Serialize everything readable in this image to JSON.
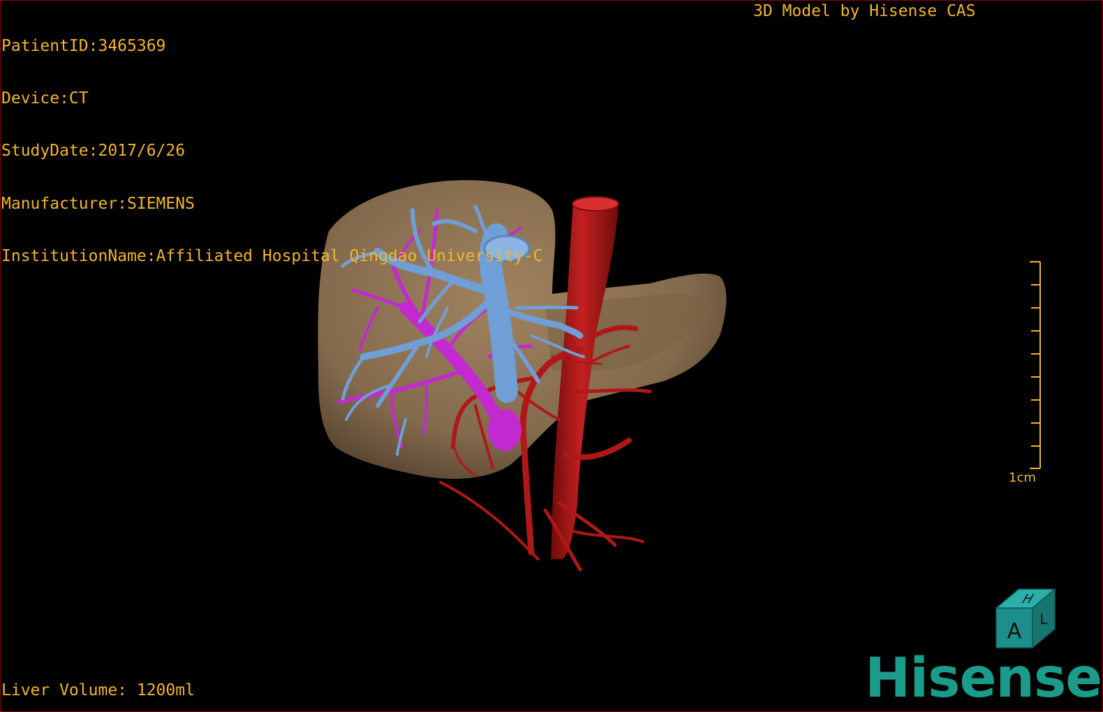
{
  "patient_info": {
    "patient_id": "PatientID:3465369",
    "device": "Device:CT",
    "study_date": "StudyDate:2017/6/26",
    "manufacturer": "Manufacturer:SIEMENS",
    "institution": "InstitutionName:Affiliated Hospital Qingdao University-C"
  },
  "model_credit": "3D Model by Hisense CAS",
  "liver_volume": "Liver Volume: 1200ml",
  "scale_bar": {
    "label": "1cm"
  },
  "orientation_cube": {
    "front_label": "A",
    "top_label": "H",
    "side_label": "L"
  },
  "brand": "Hisense",
  "colors": {
    "overlay_text": "#f2b52a",
    "liver": "#8b7051",
    "portal_vein": "#6f9fd6",
    "hepatic_vein": "#c22ad0",
    "artery": "#b01818",
    "brand": "#1a9c8a",
    "border": "#8a0000"
  },
  "icons": {
    "orientation_cube": "orientation-cube-icon",
    "scale_bar": "scale-bar-icon"
  }
}
